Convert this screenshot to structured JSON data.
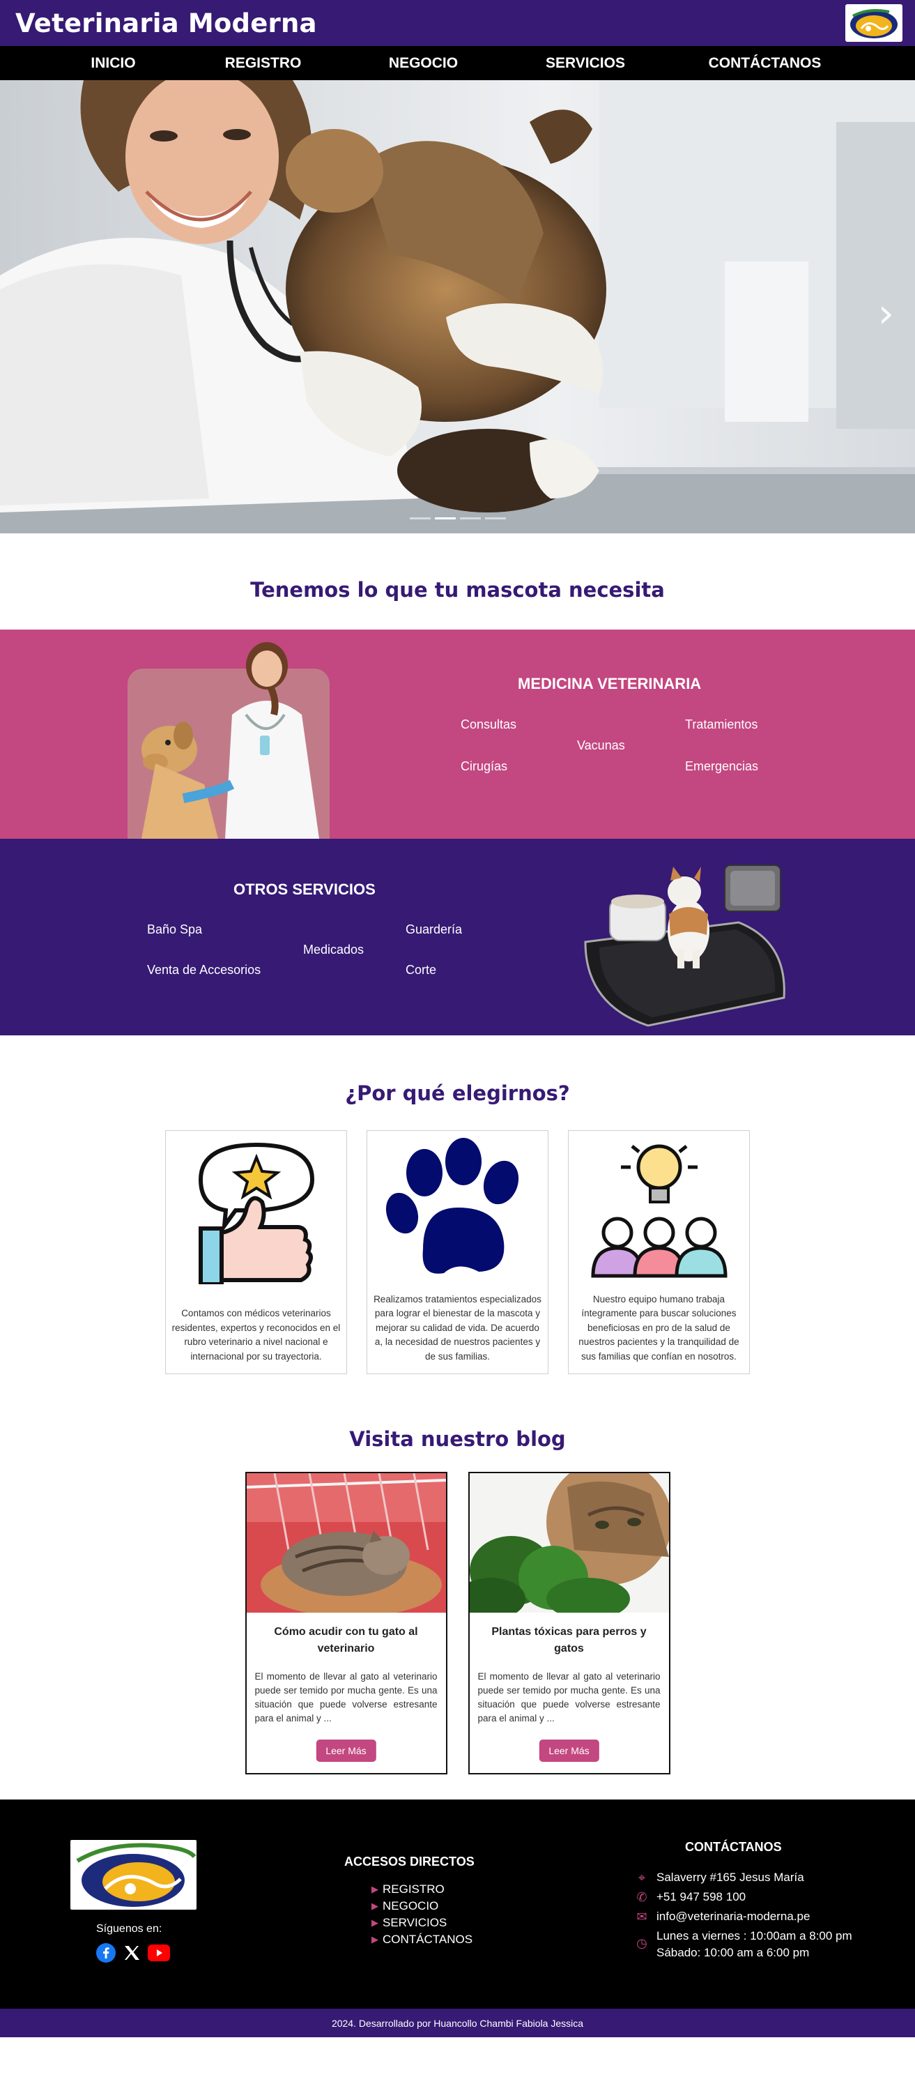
{
  "header": {
    "brand": "Veterinaria Moderna",
    "nav": [
      "INICIO",
      "REGISTRO",
      "NEGOCIO",
      "SERVICIOS",
      "CONTÁCTANOS"
    ]
  },
  "hero": {
    "next_arrow": "›",
    "slide_count": 4,
    "active_slide": 2
  },
  "intro": {
    "title": "Tenemos lo que tu mascota necesita"
  },
  "medicina": {
    "title": "MEDICINA VETERINARIA",
    "items": [
      "Consultas",
      "Tratamientos",
      "Vacunas",
      "Cirugías",
      "Emergencias"
    ]
  },
  "otros": {
    "title": "OTROS SERVICIOS",
    "items": [
      "Baño Spa",
      "Guardería",
      "Medicados",
      "Venta de Accesorios",
      "Corte"
    ]
  },
  "why": {
    "title": "¿Por qué elegirnos?",
    "cards": [
      {
        "icon": "thumbs-up-star-icon",
        "text": "Contamos con médicos veterinarios residentes, expertos y reconocidos en el rubro veterinario a nivel nacional e internacional por su trayectoria."
      },
      {
        "icon": "paw-icon",
        "text": "Realizamos tratamientos especializados para lograr el bienestar de la mascota y mejorar su calidad de vida. De acuerdo a, la necesidad de nuestros pacientes y de sus familias."
      },
      {
        "icon": "team-idea-icon",
        "text": "Nuestro equipo humano trabaja íntegramente para buscar soluciones beneficiosas en pro de la salud de nuestros pacientes y la tranquilidad de sus familias que confían en nosotros."
      }
    ]
  },
  "blog": {
    "title": "Visita nuestro blog",
    "posts": [
      {
        "title": "Cómo acudir con tu gato al veterinario",
        "excerpt": "El momento de llevar al gato al veterinario puede ser temido por mucha gente. Es una situación que puede volverse estresante para el animal y ...",
        "button": "Leer Más"
      },
      {
        "title": "Plantas tóxicas para perros y gatos",
        "excerpt": "El momento de llevar al gato al veterinario puede ser temido por mucha gente. Es una situación que puede volverse estresante para el animal y ...",
        "button": "Leer Más"
      }
    ]
  },
  "footer": {
    "follow": "Síguenos en:",
    "social": [
      "facebook-icon",
      "x-icon",
      "youtube-icon"
    ],
    "links_title": "ACCESOS DIRECTOS",
    "links": [
      "REGISTRO",
      "NEGOCIO",
      "SERVICIOS",
      "CONTÁCTANOS"
    ],
    "contact_title": "CONTÁCTANOS",
    "address": "Salaverry #165 Jesus María",
    "phone": "+51 947 598 100",
    "email": "info@veterinaria-moderna.pe",
    "hours_weekday": "Lunes a viernes : 10:00am a 8:00 pm",
    "hours_saturday": "Sábado: 10:00 am a 6:00 pm",
    "copyright": "2024. Desarrollado por Huancollo Chambi Fabiola Jessica"
  },
  "colors": {
    "primary": "#361a74",
    "accent": "#c34780",
    "nav": "#000000"
  }
}
